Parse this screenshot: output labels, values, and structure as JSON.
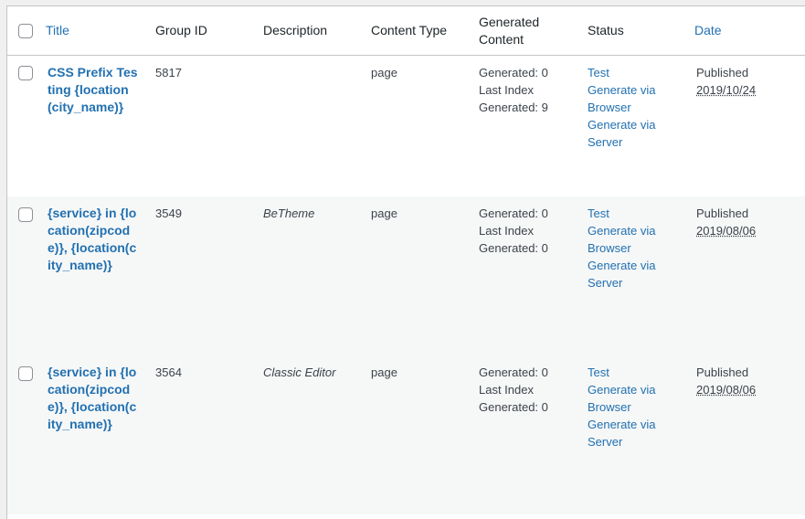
{
  "header": {
    "title": "Title",
    "group_id": "Group ID",
    "description": "Description",
    "content_type": "Content Type",
    "generated_content": "Generated Content",
    "status": "Status",
    "date": "Date"
  },
  "rows": [
    {
      "title": "CSS Prefix Testing {location(city_name)}",
      "group_id": "5817",
      "description": "",
      "content_type": "page",
      "generated": "Generated: 0",
      "last_index": "Last Index",
      "generated2": "Generated: 9",
      "status_test": "Test",
      "status_browser": "Generate via Browser",
      "status_server": "Generate via Server",
      "date_status": "Published",
      "date_value": "2019/10/24"
    },
    {
      "title": "{service} in {location(zipcode)}, {location(city_name)}",
      "group_id": "3549",
      "description": "BeTheme",
      "content_type": "page",
      "generated": "Generated: 0",
      "last_index": "Last Index",
      "generated2": "Generated: 0",
      "status_test": "Test",
      "status_browser": "Generate via Browser",
      "status_server": "Generate via Server",
      "date_status": "Published",
      "date_value": "2019/08/06"
    },
    {
      "title": "{service} in {location(zipcode)}, {location(city_name)}",
      "group_id": "3564",
      "description": "Classic Editor",
      "content_type": "page",
      "generated": "Generated: 0",
      "last_index": "Last Index",
      "generated2": "Generated: 0",
      "status_test": "Test",
      "status_browser": "Generate via Browser",
      "status_server": "Generate via Server",
      "date_status": "Published",
      "date_value": "2019/08/06"
    }
  ],
  "colors": {
    "link": "#2271b1",
    "text": "#3c434a",
    "alt_row": "#f6f7f7",
    "border": "#c3c4c7"
  }
}
